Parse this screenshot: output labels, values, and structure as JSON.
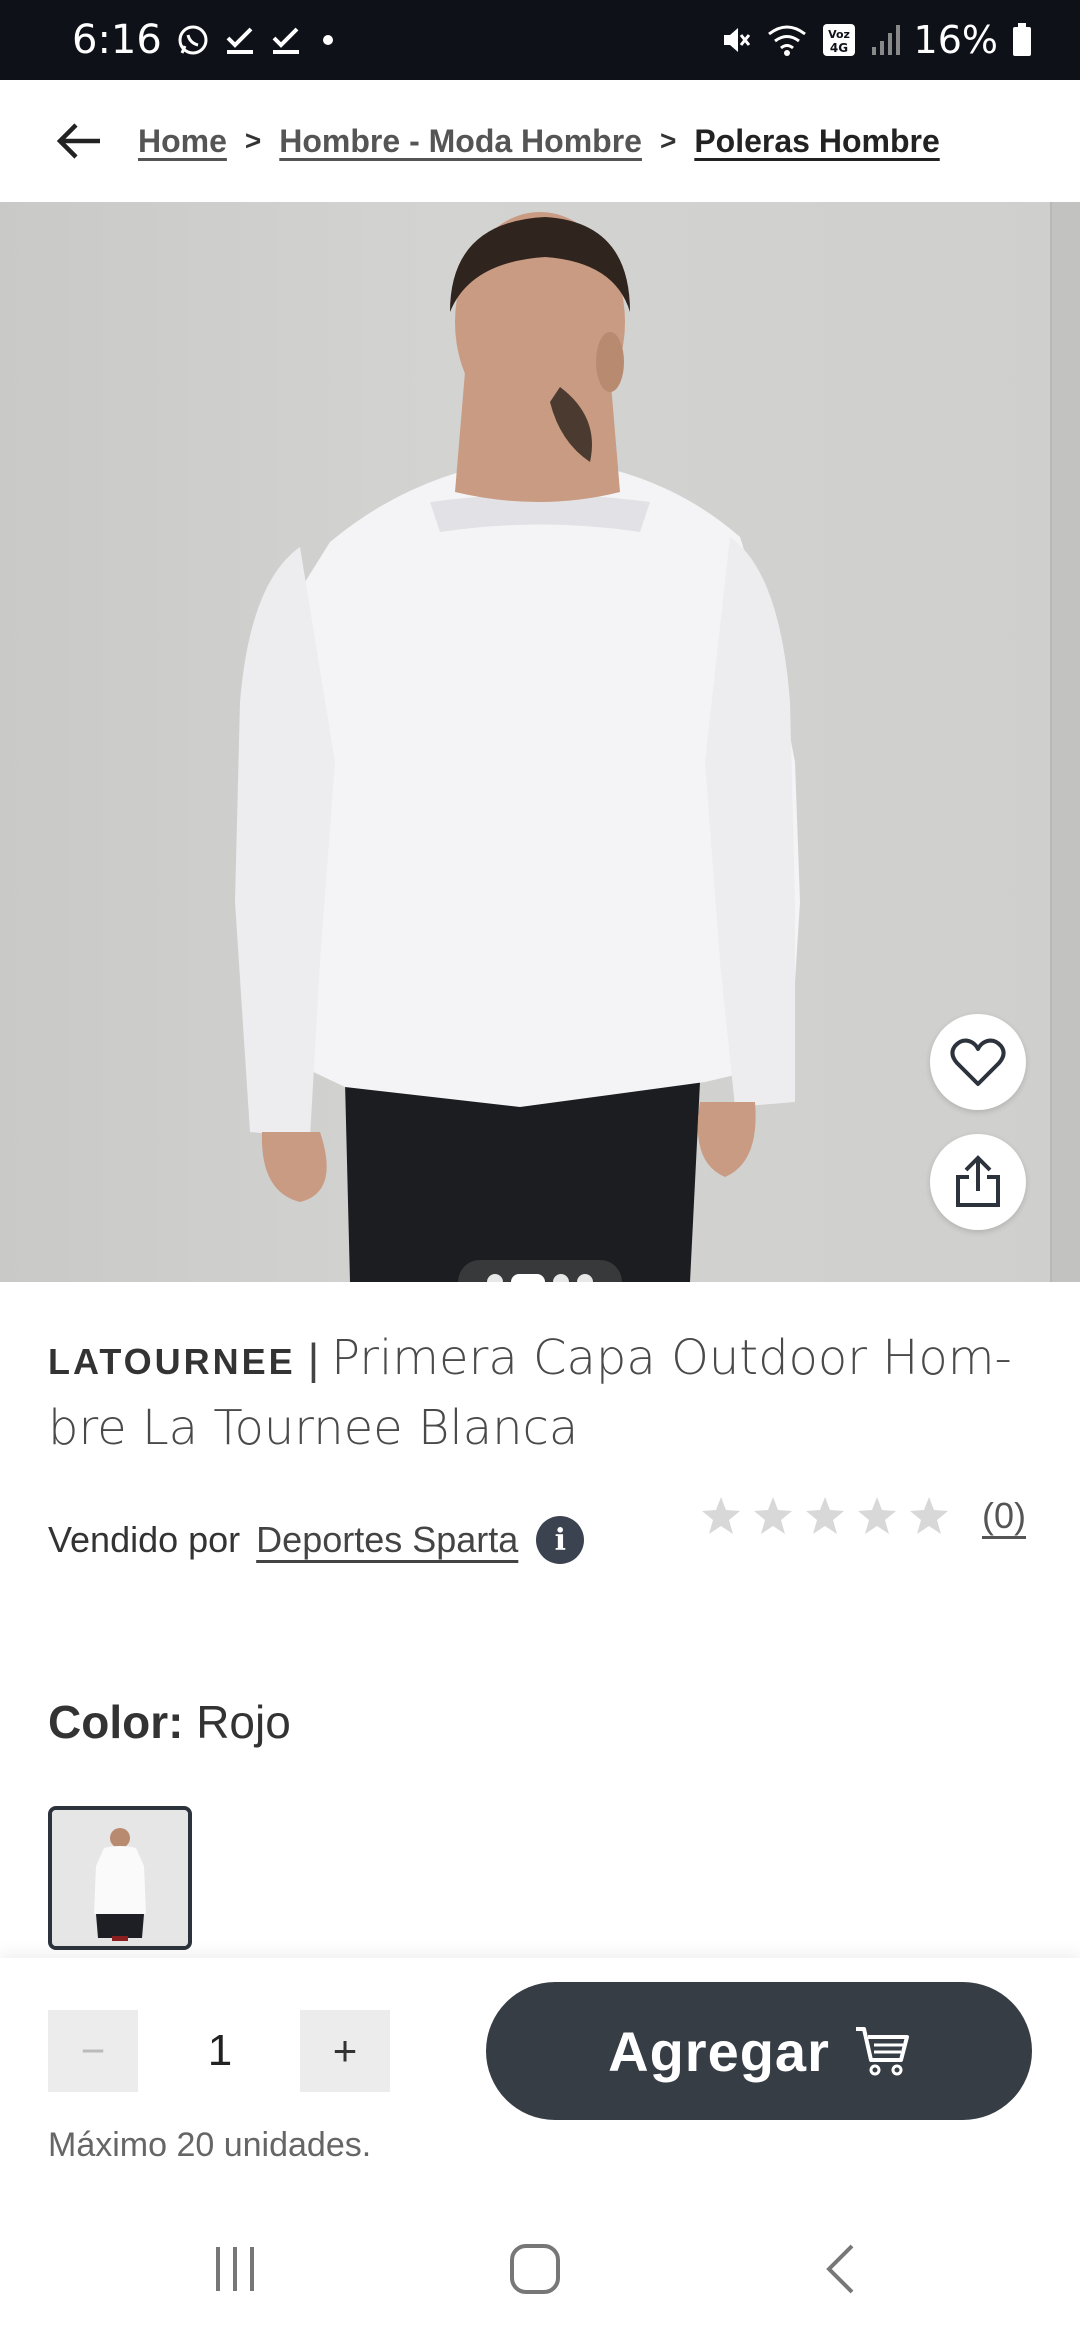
{
  "status_bar": {
    "time": "6:16",
    "battery_percent": "16%",
    "network_badge": "Voz 4G",
    "icons": [
      "whatsapp-icon",
      "check-icon",
      "check-icon",
      "dot-icon",
      "mute-icon",
      "wifi-icon",
      "signal-icon",
      "battery-icon"
    ]
  },
  "breadcrumb": {
    "items": [
      "Home",
      "Hombre - Moda Hombre",
      "Poleras Hombre"
    ],
    "separator": ">"
  },
  "gallery": {
    "page_count": 4,
    "active_index": 1
  },
  "product": {
    "brand": "LATOURNEE",
    "title_separator": "|",
    "name": "Primera Capa Outdoor Hom-bre La Tournee Blanca",
    "seller_prefix": "Vendido por",
    "seller_name": "Deportes Sparta",
    "rating_stars": 0,
    "rating_max": 5,
    "rating_count": "(0)",
    "color_label": "Color:",
    "color_value": "Rojo"
  },
  "cart": {
    "minus": "−",
    "quantity": "1",
    "plus": "+",
    "add_label": "Agregar",
    "max_note": "Máximo 20 unidades."
  },
  "colors": {
    "status_bg": "#0f1118",
    "button_dark": "#373d45",
    "info_badge": "#3b4350",
    "star_empty": "#d8d8d8"
  }
}
